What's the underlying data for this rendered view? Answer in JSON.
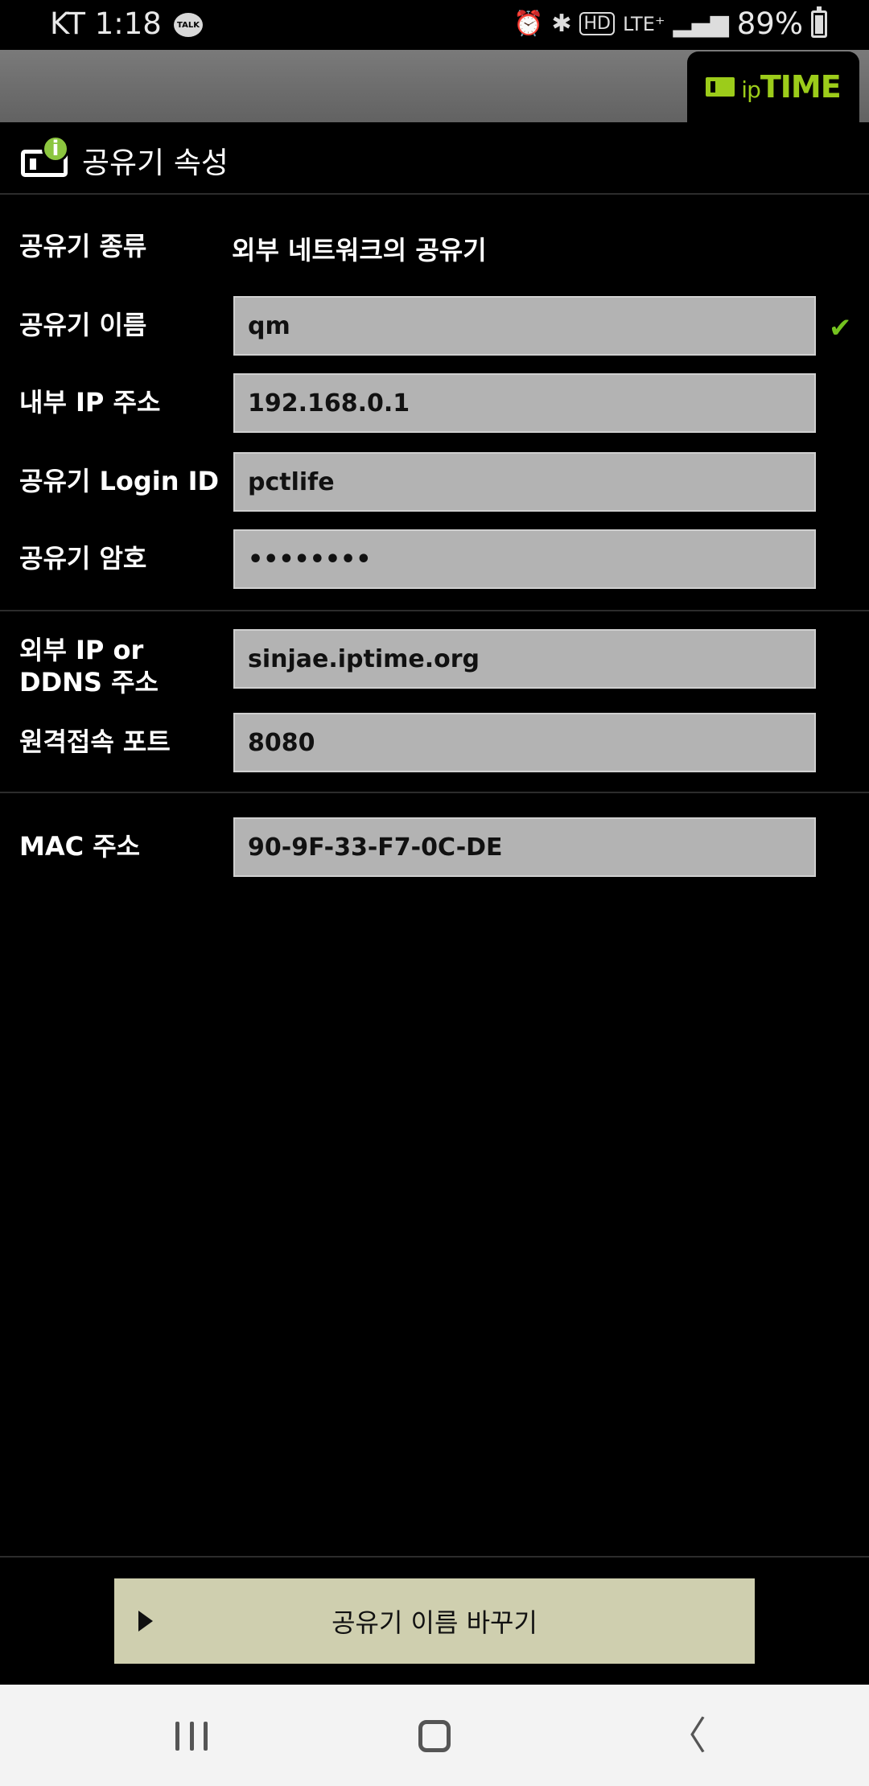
{
  "status_bar": {
    "carrier_time": "KT 1:18",
    "talk_badge": "TALK",
    "icons": [
      "alarm-icon",
      "bluetooth-icon",
      "hd-icon",
      "lte-icon",
      "signal-icon"
    ],
    "hd_label": "HD",
    "lte_label": "LTE⁺",
    "battery_text": "89%"
  },
  "header": {
    "logo_prefix": "ip",
    "logo_main": "TIME",
    "brand_color": "#9ccc1a"
  },
  "section": {
    "title": "공유기 속성"
  },
  "fields": {
    "router_type": {
      "label": "공유기 종류",
      "value": "외부 네트워크의 공유기"
    },
    "router_name": {
      "label": "공유기 이름",
      "value": "qm"
    },
    "internal_ip": {
      "label": "내부 IP 주소",
      "value": "192.168.0.1"
    },
    "login_id": {
      "label": "공유기 Login ID",
      "value": "pctlife"
    },
    "password": {
      "label": "공유기 암호",
      "value": "••••••••"
    },
    "external_ip": {
      "label_line1": "외부 IP or",
      "label_line2": "DDNS 주소",
      "value": "sinjae.iptime.org"
    },
    "remote_port": {
      "label": "원격접속 포트",
      "value": "8080"
    },
    "mac": {
      "label": "MAC 주소",
      "value": "90-9F-33-F7-0C-DE"
    }
  },
  "actions": {
    "rename_label": "공유기 이름 바꾸기"
  },
  "colors": {
    "accent_check": "#74c21f",
    "field_bg": "#b3b3b3",
    "button_bg": "#cfcfaf"
  }
}
